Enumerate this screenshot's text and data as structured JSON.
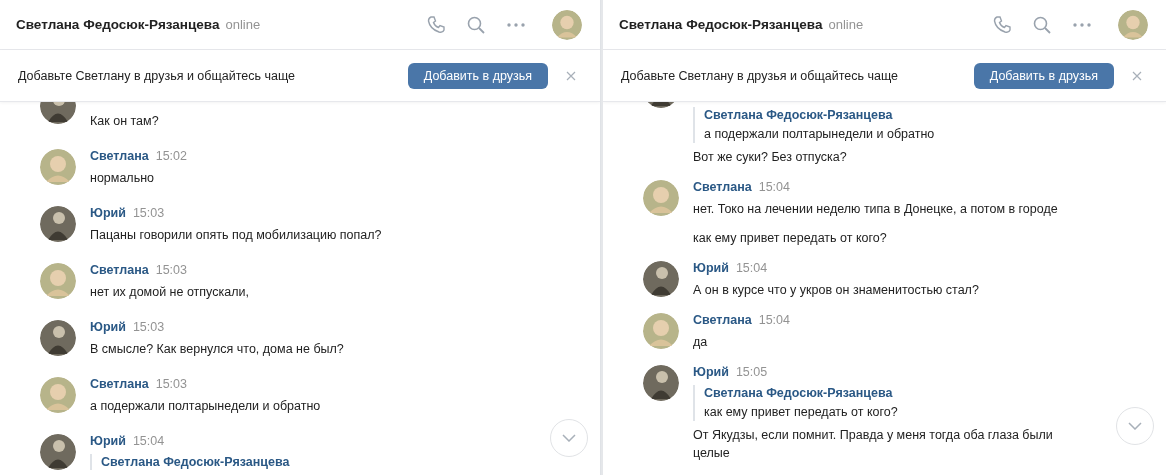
{
  "panels": [
    {
      "header": {
        "name": "Светлана Федосюк-Рязанцева",
        "status": "online"
      },
      "banner": {
        "text": "Добавьте Светлану в друзья и общайтесь чаще",
        "button": "Добавить в друзья"
      },
      "messages": [
        {
          "kind": "dark",
          "lines": [
            "Как он там?"
          ]
        },
        {
          "kind": "light",
          "author": "Светлана",
          "time": "15:02",
          "lines": [
            "нормально"
          ]
        },
        {
          "kind": "dark",
          "author": "Юрий",
          "time": "15:03",
          "lines": [
            "Пацаны говорили опять под мобилизацию попал?"
          ]
        },
        {
          "kind": "light",
          "author": "Светлана",
          "time": "15:03",
          "lines": [
            "нет их домой не отпускали,"
          ]
        },
        {
          "kind": "dark",
          "author": "Юрий",
          "time": "15:03",
          "lines": [
            "В смысле? Как вернулся что, дома не был?"
          ]
        },
        {
          "kind": "light",
          "author": "Светлана",
          "time": "15:03",
          "lines": [
            "а подержали полтарынедели и обратно"
          ]
        },
        {
          "kind": "dark",
          "author": "Юрий",
          "time": "15:04",
          "quote": {
            "author": "Светлана Федосюк-Рязанцева"
          }
        }
      ]
    },
    {
      "header": {
        "name": "Светлана Федосюк-Рязанцева",
        "status": "online"
      },
      "banner": {
        "text": "Добавьте Светлану в друзья и общайтесь чаще",
        "button": "Добавить в друзья"
      },
      "messages": [
        {
          "kind": "dark",
          "quote": {
            "author": "Светлана Федосюк-Рязанцева",
            "text": "а подержали полтарынедели и обратно"
          },
          "lines": [
            "Вот же суки? Без отпуска?"
          ]
        },
        {
          "kind": "light",
          "author": "Светлана",
          "time": "15:04",
          "lines": [
            "нет. Токо на лечении неделю типа в Донецке, а потом в городе",
            "как ему привет передать от кого?"
          ]
        },
        {
          "kind": "dark",
          "author": "Юрий",
          "time": "15:04",
          "lines": [
            "А он в курсе что у укров он знаменитостью стал?"
          ]
        },
        {
          "kind": "light",
          "author": "Светлана",
          "time": "15:04",
          "lines": [
            "да"
          ]
        },
        {
          "kind": "dark",
          "author": "Юрий",
          "time": "15:05",
          "quote": {
            "author": "Светлана Федосюк-Рязанцева",
            "text": "как ему привет передать от кого?"
          },
          "lines": [
            "От Якудзы, если помнит. Правда у меня тогда оба глаза были целые"
          ]
        }
      ]
    }
  ]
}
